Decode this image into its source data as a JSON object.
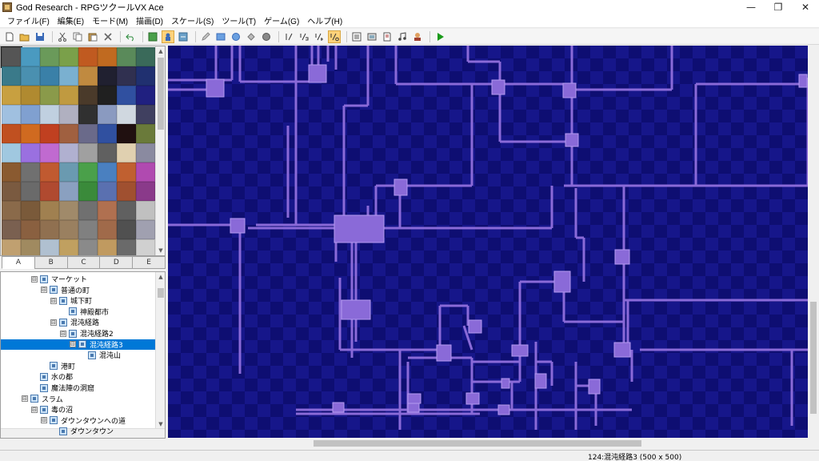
{
  "window": {
    "title": "God Research - RPGツクールVX Ace",
    "minimize_glyph": "—",
    "maximize_glyph": "❐",
    "close_glyph": "✕"
  },
  "menu": [
    {
      "label": "ファイル(F)"
    },
    {
      "label": "編集(E)"
    },
    {
      "label": "モード(M)"
    },
    {
      "label": "描画(D)"
    },
    {
      "label": "スケール(S)"
    },
    {
      "label": "ツール(T)"
    },
    {
      "label": "ゲーム(G)"
    },
    {
      "label": "ヘルプ(H)"
    }
  ],
  "toolbar": {
    "file_icons": [
      "new-file-icon",
      "open-folder-icon",
      "save-icon"
    ],
    "edit_icons": [
      "cut-icon",
      "copy-icon",
      "paste-icon",
      "delete-icon"
    ],
    "undo_icon": "undo-icon",
    "layer_icons": [
      "map-mode-icon",
      "event-mode-icon",
      "region-mode-icon"
    ],
    "draw_icons": [
      "pencil-icon",
      "rectangle-icon",
      "ellipse-icon",
      "fill-icon",
      "shadow-pen-icon"
    ],
    "scale_icons": [
      "scale-1-1-icon",
      "scale-1-2-icon",
      "scale-1-4-icon",
      "scale-1-8-icon"
    ],
    "tool_icons": [
      "database-icon",
      "resource-manager-icon",
      "script-editor-icon",
      "sound-test-icon",
      "character-generator-icon"
    ],
    "playtest_icon": "playtest-icon",
    "accent_color": "#ffd27a",
    "playtest_color": "#1a9a1a"
  },
  "palette": {
    "tabs": [
      "A",
      "B",
      "C",
      "D",
      "E"
    ],
    "active_tab": "A"
  },
  "tree": {
    "items": [
      {
        "label": "マーケット",
        "level": 3,
        "expander": "⊟"
      },
      {
        "label": "普通の町",
        "level": 4,
        "expander": "⊟"
      },
      {
        "label": "城下町",
        "level": 5,
        "expander": "⊟"
      },
      {
        "label": "神殿都市",
        "level": 6,
        "expander": ""
      },
      {
        "label": "混沌経路",
        "level": 5,
        "expander": "⊟"
      },
      {
        "label": "混沌経路2",
        "level": 6,
        "expander": "⊟"
      },
      {
        "label": "混沌経路3",
        "level": 7,
        "expander": "⊟",
        "selected": true
      },
      {
        "label": "混沌山",
        "level": 8,
        "expander": ""
      },
      {
        "label": "港町",
        "level": 4,
        "expander": ""
      },
      {
        "label": "水の都",
        "level": 3,
        "expander": ""
      },
      {
        "label": "魔法陣の洞窟",
        "level": 3,
        "expander": ""
      },
      {
        "label": "スラム",
        "level": 2,
        "expander": "⊟"
      },
      {
        "label": "毒の沼",
        "level": 3,
        "expander": "⊟"
      },
      {
        "label": "ダウンタウンへの道",
        "level": 4,
        "expander": "⊟"
      },
      {
        "label": "ダウンタウン",
        "level": 5,
        "expander": ""
      }
    ]
  },
  "map": {
    "background_color": "#0e0e72",
    "path_color": "#8a6ad8"
  },
  "status": {
    "map_info": "124:混沌経路3 (500 x 500)"
  }
}
